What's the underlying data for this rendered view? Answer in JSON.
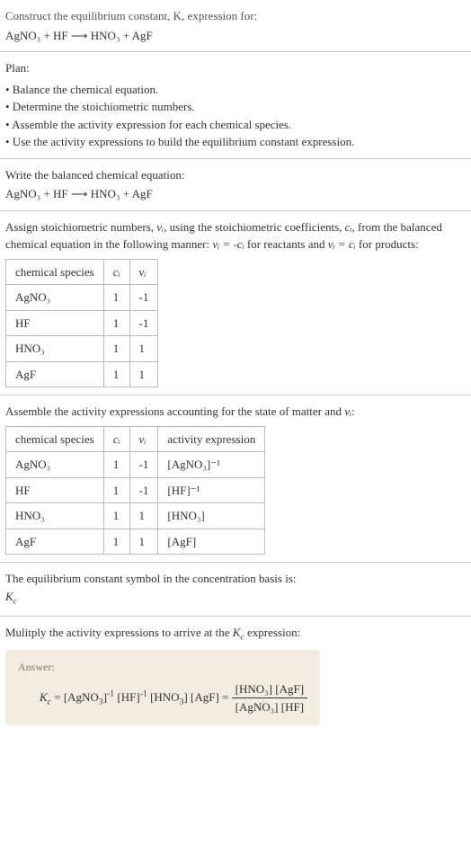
{
  "intro": {
    "line1": "Construct the equilibrium constant, K, expression for:",
    "equation": "AgNO₃ + HF ⟶ HNO₃ + AgF"
  },
  "plan": {
    "heading": "Plan:",
    "items": [
      "• Balance the chemical equation.",
      "• Determine the stoichiometric numbers.",
      "• Assemble the activity expression for each chemical species.",
      "• Use the activity expressions to build the equilibrium constant expression."
    ]
  },
  "balanced": {
    "heading": "Write the balanced chemical equation:",
    "equation": "AgNO₃ + HF ⟶ HNO₃ + AgF"
  },
  "stoich": {
    "text_a": "Assign stoichiometric numbers, ",
    "nu_i": "νᵢ",
    "text_b": ", using the stoichiometric coefficients, ",
    "c_i": "cᵢ",
    "text_c": ", from the balanced chemical equation in the following manner: ",
    "rel1": "νᵢ = -cᵢ",
    "text_d": " for reactants and ",
    "rel2": "νᵢ = cᵢ",
    "text_e": " for products:",
    "headers": [
      "chemical species",
      "cᵢ",
      "νᵢ"
    ],
    "rows": [
      {
        "species": "AgNO₃",
        "c": "1",
        "nu": "-1"
      },
      {
        "species": "HF",
        "c": "1",
        "nu": "-1"
      },
      {
        "species": "HNO₃",
        "c": "1",
        "nu": "1"
      },
      {
        "species": "AgF",
        "c": "1",
        "nu": "1"
      }
    ]
  },
  "activity": {
    "heading_a": "Assemble the activity expressions accounting for the state of matter and ",
    "nu_i": "νᵢ",
    "heading_b": ":",
    "headers": [
      "chemical species",
      "cᵢ",
      "νᵢ",
      "activity expression"
    ],
    "rows": [
      {
        "species": "AgNO₃",
        "c": "1",
        "nu": "-1",
        "act": "[AgNO₃]⁻¹"
      },
      {
        "species": "HF",
        "c": "1",
        "nu": "-1",
        "act": "[HF]⁻¹"
      },
      {
        "species": "HNO₃",
        "c": "1",
        "nu": "1",
        "act": "[HNO₃]"
      },
      {
        "species": "AgF",
        "c": "1",
        "nu": "1",
        "act": "[AgF]"
      }
    ]
  },
  "symbol": {
    "line1": "The equilibrium constant symbol in the concentration basis is:",
    "kc": "K_c"
  },
  "multiply": {
    "heading_a": "Mulitply the activity expressions to arrive at the ",
    "kc": "K_c",
    "heading_b": " expression:"
  },
  "answer": {
    "label": "Answer:",
    "lhs": "K_c = [AgNO₃]⁻¹ [HF]⁻¹ [HNO₃] [AgF] = ",
    "num": "[HNO₃] [AgF]",
    "den": "[AgNO₃] [HF]"
  },
  "chart_data": {
    "type": "table",
    "tables": [
      {
        "name": "stoichiometric_numbers",
        "columns": [
          "chemical species",
          "c_i",
          "nu_i"
        ],
        "rows": [
          [
            "AgNO3",
            1,
            -1
          ],
          [
            "HF",
            1,
            -1
          ],
          [
            "HNO3",
            1,
            1
          ],
          [
            "AgF",
            1,
            1
          ]
        ]
      },
      {
        "name": "activity_expressions",
        "columns": [
          "chemical species",
          "c_i",
          "nu_i",
          "activity expression"
        ],
        "rows": [
          [
            "AgNO3",
            1,
            -1,
            "[AgNO3]^-1"
          ],
          [
            "HF",
            1,
            -1,
            "[HF]^-1"
          ],
          [
            "HNO3",
            1,
            1,
            "[HNO3]"
          ],
          [
            "AgF",
            1,
            1,
            "[AgF]"
          ]
        ]
      }
    ],
    "equilibrium_constant": "K_c = [HNO3][AgF] / ([AgNO3][HF])"
  }
}
